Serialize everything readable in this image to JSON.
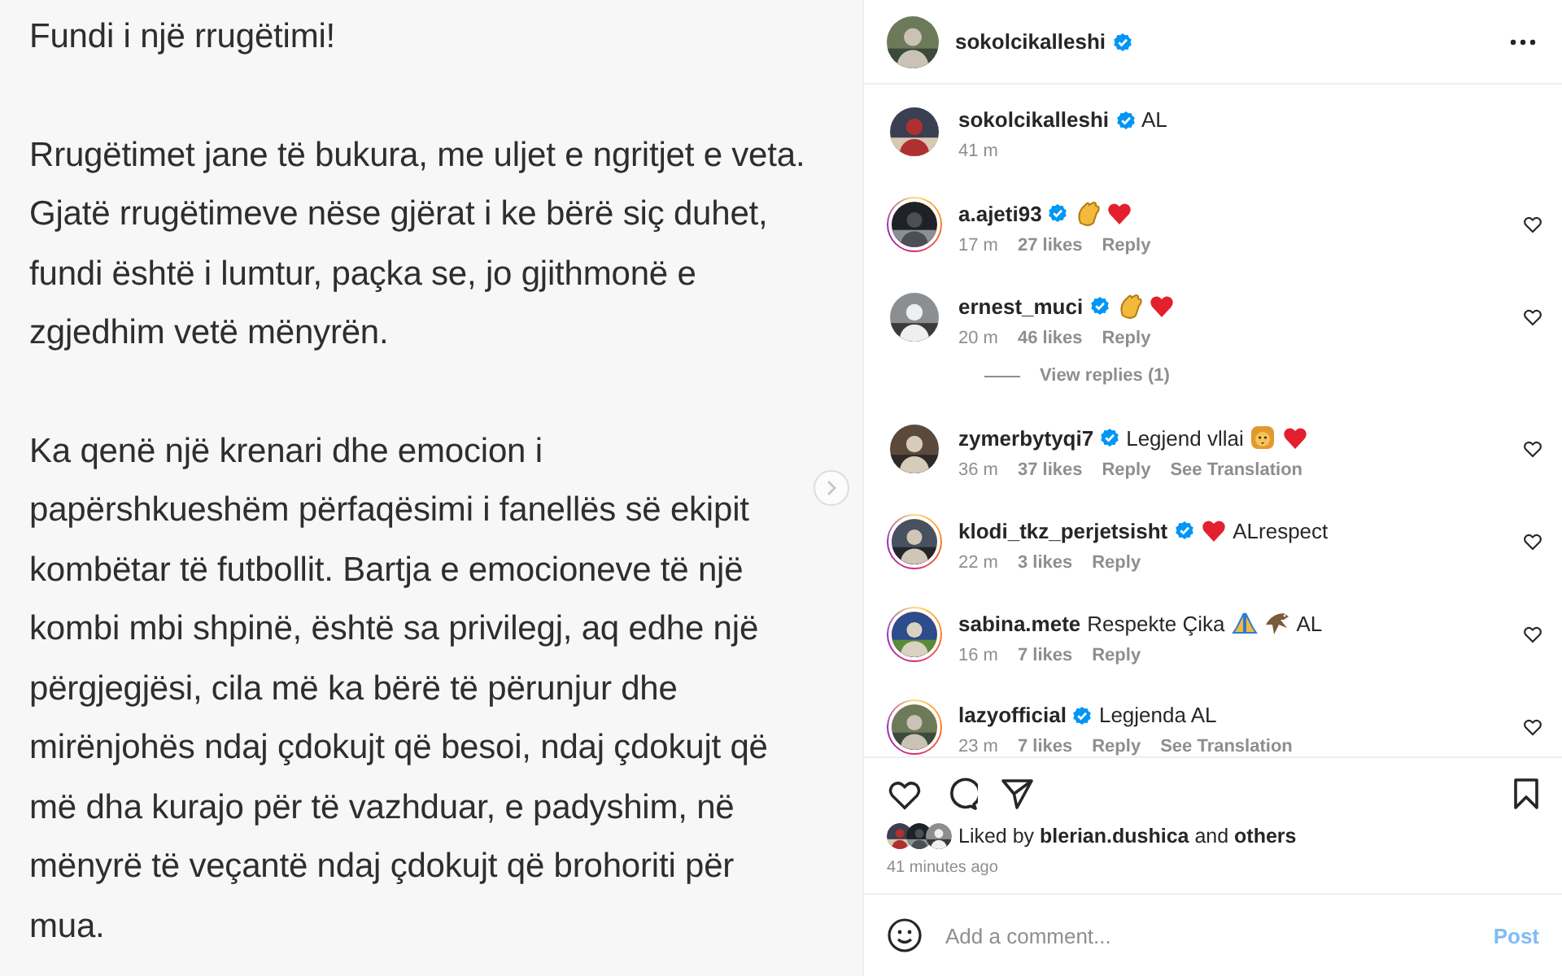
{
  "post_text": {
    "paragraphs": [
      "Fundi i një rrugëtimi!",
      "Rrugëtimet jane të bukura, me uljet e ngritjet e veta. Gjatë rrugëtimeve nëse gjërat i ke bërë siç duhet, fundi është i lumtur, paçka se, jo gjithmonë e zgjedhim vetë mënyrën.",
      "Ka qenë një krenari dhe emocion i papërshkueshëm përfaqësimi i fanellës së ekipit kombëtar të futbollit. Bartja e emocioneve të një kombi mbi shpinë, është sa privilegj, aq edhe një përgjegjësi, cila më ka bërë të përunjur dhe mirënjohës ndaj çdokujt që besoi, ndaj çdokujt që më dha kurajo për të vazhduar, e padyshim, në mënyrë të veçantë ndaj çdokujt që brohoriti për mua."
    ]
  },
  "header": {
    "username": "sokolcikalleshi",
    "verified": true
  },
  "caption": {
    "username": "sokolcikalleshi",
    "verified": true,
    "parts": [
      {
        "kind": "text",
        "text": "AL"
      }
    ],
    "time": "41 m"
  },
  "comments": [
    {
      "username": "a.ajeti93",
      "verified": true,
      "story": true,
      "parts": [
        {
          "kind": "clap"
        },
        {
          "kind": "heart"
        }
      ],
      "time": "17 m",
      "likes": "27 likes",
      "reply": "Reply",
      "liked": false
    },
    {
      "username": "ernest_muci",
      "verified": true,
      "story": false,
      "parts": [
        {
          "kind": "clap"
        },
        {
          "kind": "heart"
        }
      ],
      "time": "20 m",
      "likes": "46 likes",
      "reply": "Reply",
      "liked": false,
      "view_replies": "View replies (1)"
    },
    {
      "username": "zymerbytyqi7",
      "verified": true,
      "story": false,
      "parts": [
        {
          "kind": "text",
          "text": "Legjend vllai"
        },
        {
          "kind": "lion"
        },
        {
          "kind": "heart"
        }
      ],
      "time": "36 m",
      "likes": "37 likes",
      "reply": "Reply",
      "translation": "See Translation",
      "liked": false
    },
    {
      "username": "klodi_tkz_perjetsisht",
      "verified": true,
      "story": true,
      "parts": [
        {
          "kind": "heart"
        },
        {
          "kind": "text",
          "text": "ALrespect"
        }
      ],
      "time": "22 m",
      "likes": "3 likes",
      "reply": "Reply",
      "liked": false
    },
    {
      "username": "sabina.mete",
      "verified": false,
      "story": true,
      "parts": [
        {
          "kind": "text",
          "text": "Respekte Çika"
        },
        {
          "kind": "pray"
        },
        {
          "kind": "eagle"
        },
        {
          "kind": "text",
          "text": "AL"
        }
      ],
      "time": "16 m",
      "likes": "7 likes",
      "reply": "Reply",
      "liked": false
    },
    {
      "username": "lazyofficial",
      "verified": true,
      "story": true,
      "parts": [
        {
          "kind": "text",
          "text": "Legjenda AL"
        }
      ],
      "time": "23 m",
      "likes": "7 likes",
      "reply": "Reply",
      "translation": "See Translation",
      "liked": false
    }
  ],
  "actions": {
    "liked": false,
    "saved": false
  },
  "liked_by": "Liked by **blerian.dushica** and **others**",
  "posted": "41 minutes ago",
  "comment_field": {
    "placeholder": "Add a comment...",
    "post_button": "Post",
    "disabled": true
  }
}
